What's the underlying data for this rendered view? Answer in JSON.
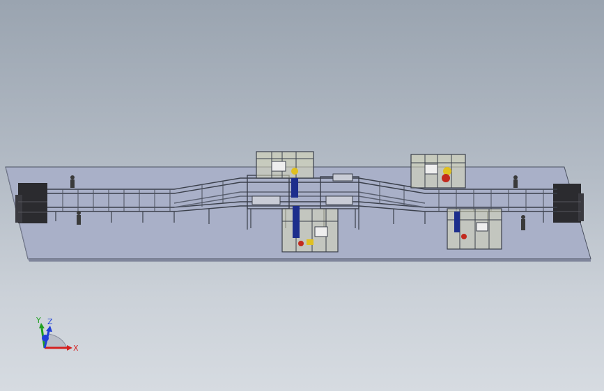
{
  "viewport": {
    "background_top": "#9aa4b0",
    "background_bottom": "#d6dbe1"
  },
  "triad": {
    "x_label": "X",
    "y_label": "Y",
    "z_label": "Z",
    "x_color": "#d42020",
    "y_color": "#1fa01f",
    "z_color": "#2040d8"
  },
  "model": {
    "platform_color": "#a9b0c8",
    "frame_color": "#3a3f4a",
    "cabinet_color": "#2b2b2f",
    "cell_fill": "#d9d8b8",
    "robot_blue": "#1d2e8c",
    "accent_red": "#c22a1e",
    "accent_yellow": "#e0c020"
  }
}
